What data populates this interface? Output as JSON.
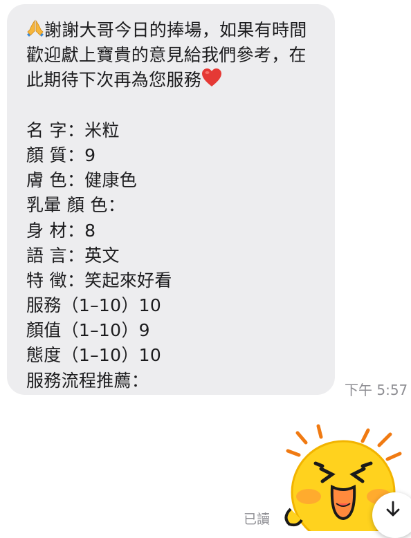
{
  "message": {
    "line1": "謝謝大哥今日的捧場，如果有時間",
    "line2": "歡迎獻上寶貴的意見給我們參考，在",
    "line3": "此期待下次再為您服務",
    "name": "名 字：米粒",
    "looks": "顏 質：9",
    "skin": "膚 色：健康色",
    "areola": "乳暈 顏 色：",
    "body": "身 材：8",
    "language": "語 言：英文",
    "feature": "特 徵：笑起來好看",
    "service": "服務（1–10）10",
    "appearance": "顏值（1–10）9",
    "attitude": "態度（1–10）10",
    "flow": "服務流程推薦："
  },
  "timestamp": "下午 5:57",
  "read_status": "已讀",
  "icons": {
    "pray": "folded-hands-emoji",
    "heart": "red-heart-emoji",
    "sticker": "laughing-face-sticker",
    "scroll": "arrow-down-icon"
  },
  "colors": {
    "bubble": "#ededef",
    "meta_text": "#8e8e93",
    "heart": "#e53935",
    "sticker_face": "#ffd21e"
  }
}
